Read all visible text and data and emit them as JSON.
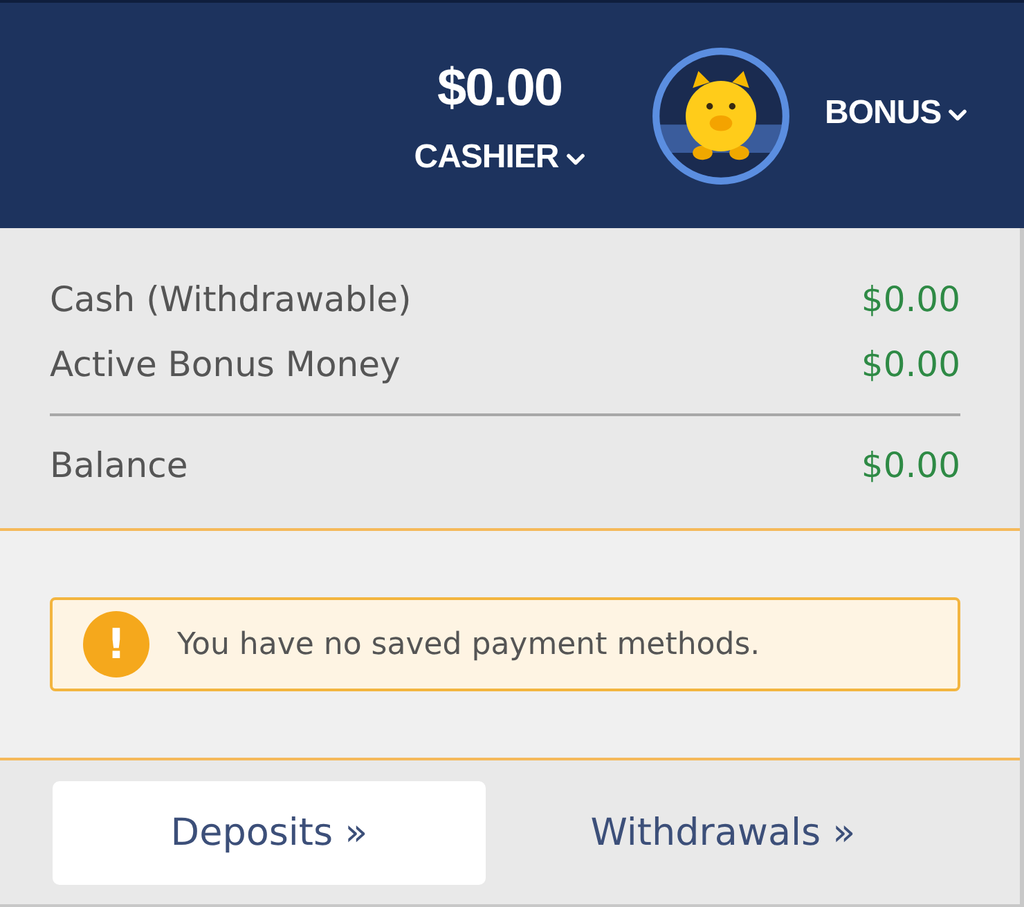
{
  "header": {
    "balance": "$0.00",
    "cashier_label": "CASHIER",
    "bonus_label": "BONUS"
  },
  "summary": [
    {
      "label": "Cash (Withdrawable)",
      "value": "$0.00"
    },
    {
      "label": "Active Bonus Money",
      "value": "$0.00"
    }
  ],
  "total": {
    "label": "Balance",
    "value": "$0.00"
  },
  "alert": {
    "icon": "!",
    "text": "You have no saved payment methods."
  },
  "tabs": [
    {
      "label": "Deposits »",
      "selected": true
    },
    {
      "label": "Withdrawals »",
      "selected": false
    }
  ]
}
